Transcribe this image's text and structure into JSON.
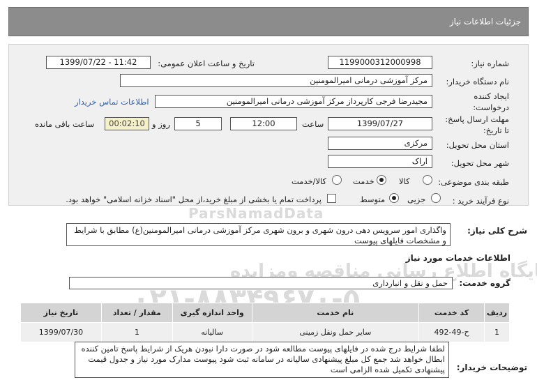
{
  "header": {
    "title": "جزئیات اطلاعات نیاز"
  },
  "fields": {
    "need_number_label": "شماره نیاز:",
    "need_number": "1199000312000998",
    "announce_label": "تاریخ و ساعت اعلان عمومی:",
    "announce_value": "1399/07/22 - 11:42",
    "buyer_label": "نام دستگاه خریدار:",
    "buyer_value": "مرکز آموزشی  درمانی امیرالمومنین",
    "creator_label": "ایجاد کننده درخواست:",
    "creator_value": "مجیدرضا فرجی کارپرداز مرکز آموزشی  درمانی امیرالمومنین",
    "contact_link": "اطلاعات تماس خریدار",
    "deadline_label": "مهلت ارسال پاسخ: تا تاریخ:",
    "deadline_date": "1399/07/27",
    "time_label": "ساعت",
    "deadline_time": "12:00",
    "days_value": "5",
    "days_label": "روز و",
    "remaining_value": "00:02:10",
    "remaining_label": "ساعت باقی مانده",
    "province_label": "استان محل تحویل:",
    "province_value": "مرکزی",
    "city_label": "شهر محل تحویل:",
    "city_value": "اراک",
    "category_label": "طبقه بندی موضوعی:",
    "category_options": [
      "کالا",
      "خدمت",
      "کالا/خدمت"
    ],
    "category_selected": "خدمت",
    "process_label": "نوع فرآیند خرید :",
    "process_options": [
      "جزیی",
      "متوسط"
    ],
    "process_selected": "متوسط",
    "treasury_note": "پرداخت تمام یا بخشی از مبلغ خرید،از محل \"اسناد خزانه اسلامی\" خواهد بود."
  },
  "summary": {
    "label": "شرح کلی نیاز:",
    "text": "واگذاری امور سرویس دهی درون شهری و برون شهری مرکز آموزشی درمانی امیرالمومنین(ع) مطابق با شرایط و مشخصات فایلهای پیوست"
  },
  "services": {
    "section_title": "اطلاعات خدمات مورد نیاز",
    "group_label": "گروه خدمت:",
    "group_value": "حمل و نقل و انبارداری",
    "columns": [
      "ردیف",
      "کد خدمت",
      "نام خدمت",
      "واحد اندازه گیری",
      "مقدار / تعداد",
      "تاریخ نیاز"
    ],
    "rows": [
      [
        "1",
        "ح-49-492",
        "سایر حمل ونقل زمینی",
        "سالیانه",
        "1",
        "1399/07/30"
      ]
    ]
  },
  "buyer_notes": {
    "label": "توضیحات خریدار:",
    "text": "لطفا شرایط درج شده در فایلهای پیوست مطالعه شود در صورت دارا نبودن هریک از شرایط پاسخ تامین کننده ابطال خواهد شد جمع کل مبلغ پیشنهادی سالیانه در سامانه ثبت شود پیوست مدارک مورد نیاز و جدول قیمت پیشنهادی تکمیل شده الزامی است"
  },
  "watermark": {
    "line1": "ParsNamadData",
    "line2": "پایگاه اطلاع رسانی مناقصه ومزایده",
    "phone": "۰۲۱-۸۸۳۴۹۶۷۰-۵"
  }
}
